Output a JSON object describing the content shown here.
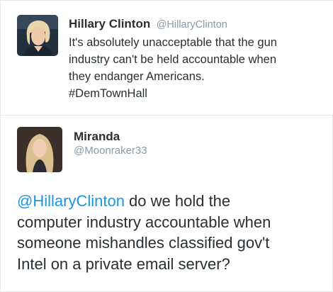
{
  "tweet1": {
    "author_name": "Hillary Clinton",
    "author_handle": "@HillaryClinton",
    "text": "It's absolutely unacceptable that the gun\nindustry can't be held accountable when\nthey endanger Americans.\n#DemTownHall"
  },
  "tweet2": {
    "author_name": "Miranda",
    "author_handle": "@Moonraker33",
    "mention": "@HillaryClinton",
    "line1_rest": " do we hold the",
    "line2": "computer industry accountable when",
    "line3": "someone mishandles classified gov't",
    "line4": "Intel on a private email server?"
  },
  "colors": {
    "text": "#292f33",
    "handle": "#8899a6",
    "link": "#1b95e0",
    "divider": "#e1e8ed"
  }
}
